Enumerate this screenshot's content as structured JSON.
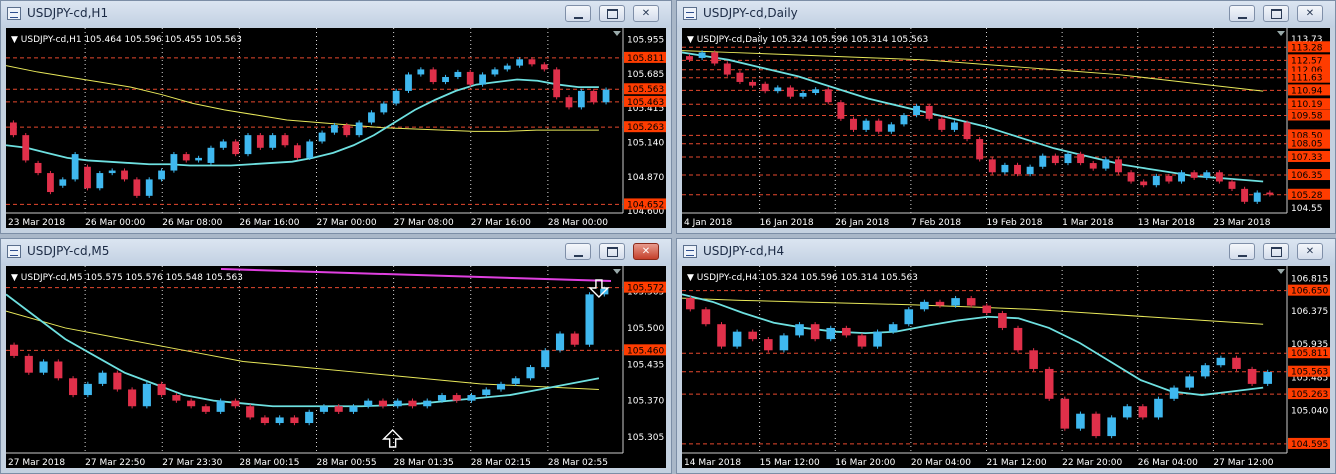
{
  "windows": [
    {
      "title": "USDJPY-cd,H1",
      "info": "▼ USDJPY-cd,H1  105.464 105.596 105.455 105.563",
      "active": false,
      "price_labels": [
        "105.955",
        "105.685",
        "105.415",
        "105.140",
        "104.870",
        "104.600"
      ],
      "tag_labels": [
        "105.811",
        "105.563",
        "105.463",
        "105.263",
        "104.652"
      ],
      "time_labels": [
        "23 Mar 2018",
        "26 Mar 00:00",
        "26 Mar 08:00",
        "26 Mar 16:00",
        "27 Mar 00:00",
        "27 Mar 08:00",
        "27 Mar 16:00",
        "28 Mar 00:00"
      ],
      "chart_data": {
        "type": "candlestick",
        "ylim": [
          104.6,
          106.0
        ],
        "candles": [
          [
            105.3,
            105.2
          ],
          [
            105.2,
            105.0
          ],
          [
            104.98,
            104.9
          ],
          [
            104.9,
            104.75
          ],
          [
            104.8,
            104.85
          ],
          [
            104.85,
            105.05
          ],
          [
            104.95,
            104.78
          ],
          [
            104.78,
            104.9
          ],
          [
            104.9,
            104.92
          ],
          [
            104.92,
            104.85
          ],
          [
            104.85,
            104.72
          ],
          [
            104.72,
            104.85
          ],
          [
            104.85,
            104.92
          ],
          [
            104.92,
            105.05
          ],
          [
            105.05,
            105.0
          ],
          [
            105.0,
            105.02
          ],
          [
            104.98,
            105.1
          ],
          [
            105.1,
            105.15
          ],
          [
            105.15,
            105.05
          ],
          [
            105.05,
            105.2
          ],
          [
            105.2,
            105.1
          ],
          [
            105.1,
            105.2
          ],
          [
            105.2,
            105.12
          ],
          [
            105.12,
            105.02
          ],
          [
            105.02,
            105.15
          ],
          [
            105.15,
            105.22
          ],
          [
            105.22,
            105.28
          ],
          [
            105.28,
            105.2
          ],
          [
            105.2,
            105.3
          ],
          [
            105.3,
            105.38
          ],
          [
            105.38,
            105.45
          ],
          [
            105.45,
            105.55
          ],
          [
            105.55,
            105.68
          ],
          [
            105.68,
            105.72
          ],
          [
            105.72,
            105.62
          ],
          [
            105.62,
            105.66
          ],
          [
            105.66,
            105.7
          ],
          [
            105.7,
            105.6
          ],
          [
            105.6,
            105.68
          ],
          [
            105.68,
            105.72
          ],
          [
            105.72,
            105.75
          ],
          [
            105.75,
            105.8
          ],
          [
            105.8,
            105.76
          ],
          [
            105.76,
            105.72
          ],
          [
            105.72,
            105.5
          ],
          [
            105.5,
            105.42
          ],
          [
            105.42,
            105.55
          ],
          [
            105.55,
            105.46
          ],
          [
            105.46,
            105.56
          ]
        ],
        "ma_fast": [
          105.12,
          105.1,
          105.06,
          105.02,
          105.0,
          104.99,
          104.98,
          104.97,
          104.97,
          104.96,
          104.96,
          104.96,
          104.97,
          104.98,
          104.99,
          105.02,
          105.06,
          105.12,
          105.2,
          105.3,
          105.4,
          105.48,
          105.55,
          105.6,
          105.62,
          105.64,
          105.63,
          105.6,
          105.58,
          105.58
        ],
        "ma_slow": [
          105.75,
          105.7,
          105.66,
          105.62,
          105.58,
          105.52,
          105.45,
          105.4,
          105.36,
          105.32,
          105.3,
          105.28,
          105.26,
          105.25,
          105.24,
          105.23,
          105.23,
          105.24,
          105.24,
          105.24
        ]
      }
    },
    {
      "title": "USDJPY-cd,Daily",
      "info": "▼ USDJPY-cd,Daily  105.324 105.596 105.314 105.563",
      "active": false,
      "price_labels": [
        "113.73",
        "113.28",
        "112.57",
        "112.06",
        "111.63",
        "110.94",
        "110.19",
        "109.58",
        "108.50",
        "108.05",
        "107.33",
        "106.35",
        "105.28",
        "104.55"
      ],
      "tag_labels": [
        "113.28",
        "112.57",
        "112.06",
        "111.63",
        "110.94",
        "110.19",
        "109.58",
        "108.50",
        "108.05",
        "107.33",
        "106.35",
        "105.28"
      ],
      "time_labels": [
        "4 Jan 2018",
        "16 Jan 2018",
        "26 Jan 2018",
        "7 Feb 2018",
        "19 Feb 2018",
        "1 Mar 2018",
        "13 Mar 2018",
        "23 Mar 2018"
      ],
      "chart_data": {
        "type": "candlestick",
        "ylim": [
          104.4,
          114.0
        ],
        "candles": [
          [
            112.8,
            112.6
          ],
          [
            112.7,
            113.0
          ],
          [
            113.0,
            112.4
          ],
          [
            112.4,
            111.8
          ],
          [
            111.9,
            111.4
          ],
          [
            111.4,
            111.2
          ],
          [
            111.3,
            110.9
          ],
          [
            110.9,
            111.1
          ],
          [
            111.1,
            110.6
          ],
          [
            110.6,
            110.8
          ],
          [
            110.8,
            111.0
          ],
          [
            111.0,
            110.3
          ],
          [
            110.3,
            109.4
          ],
          [
            109.4,
            108.8
          ],
          [
            108.8,
            109.3
          ],
          [
            109.3,
            108.7
          ],
          [
            108.7,
            109.1
          ],
          [
            109.1,
            109.6
          ],
          [
            109.6,
            110.1
          ],
          [
            110.1,
            109.4
          ],
          [
            109.4,
            108.8
          ],
          [
            108.8,
            109.2
          ],
          [
            109.2,
            108.3
          ],
          [
            108.3,
            107.2
          ],
          [
            107.2,
            106.5
          ],
          [
            106.5,
            106.9
          ],
          [
            106.9,
            106.4
          ],
          [
            106.4,
            106.8
          ],
          [
            106.8,
            107.4
          ],
          [
            107.4,
            107.0
          ],
          [
            107.0,
            107.5
          ],
          [
            107.5,
            107.0
          ],
          [
            107.0,
            106.7
          ],
          [
            106.7,
            107.2
          ],
          [
            107.2,
            106.5
          ],
          [
            106.5,
            106.0
          ],
          [
            106.0,
            105.8
          ],
          [
            105.8,
            106.3
          ],
          [
            106.3,
            106.0
          ],
          [
            106.0,
            106.5
          ],
          [
            106.5,
            106.2
          ],
          [
            106.2,
            106.5
          ],
          [
            106.5,
            106.0
          ],
          [
            106.0,
            105.6
          ],
          [
            105.6,
            104.9
          ],
          [
            104.9,
            105.4
          ],
          [
            105.4,
            105.3
          ]
        ],
        "ma_fast": [
          113.0,
          112.8,
          112.6,
          112.3,
          112.0,
          111.7,
          111.3,
          110.9,
          110.5,
          110.2,
          109.9,
          109.6,
          109.3,
          109.0,
          108.6,
          108.2,
          107.8,
          107.5,
          107.2,
          106.9,
          106.7,
          106.5,
          106.3,
          106.2,
          106.1,
          106.0
        ],
        "ma_slow": [
          113.1,
          113.0,
          112.9,
          112.8,
          112.7,
          112.6,
          112.4,
          112.2,
          112.0,
          111.8,
          111.5,
          111.2,
          110.9
        ]
      }
    },
    {
      "title": "USDJPY-cd,M5",
      "info": "▼ USDJPY-cd,M5  105.575 105.576 105.548 105.563",
      "active": true,
      "price_labels": [
        "105.565",
        "105.500",
        "105.435",
        "105.370",
        "105.305"
      ],
      "tag_labels": [
        "105.572",
        "105.460"
      ],
      "time_labels": [
        "27 Mar 2018",
        "27 Mar 22:50",
        "27 Mar 23:30",
        "28 Mar 00:15",
        "28 Mar 00:55",
        "28 Mar 01:35",
        "28 Mar 02:15",
        "28 Mar 02:55"
      ],
      "chart_data": {
        "type": "candlestick",
        "ylim": [
          105.28,
          105.6
        ],
        "candles": [
          [
            105.47,
            105.45
          ],
          [
            105.45,
            105.42
          ],
          [
            105.42,
            105.44
          ],
          [
            105.44,
            105.41
          ],
          [
            105.41,
            105.38
          ],
          [
            105.38,
            105.4
          ],
          [
            105.4,
            105.42
          ],
          [
            105.42,
            105.39
          ],
          [
            105.39,
            105.36
          ],
          [
            105.36,
            105.4
          ],
          [
            105.4,
            105.38
          ],
          [
            105.38,
            105.37
          ],
          [
            105.37,
            105.36
          ],
          [
            105.36,
            105.35
          ],
          [
            105.35,
            105.37
          ],
          [
            105.37,
            105.36
          ],
          [
            105.36,
            105.34
          ],
          [
            105.34,
            105.33
          ],
          [
            105.33,
            105.34
          ],
          [
            105.34,
            105.33
          ],
          [
            105.33,
            105.35
          ],
          [
            105.35,
            105.36
          ],
          [
            105.36,
            105.35
          ],
          [
            105.35,
            105.36
          ],
          [
            105.36,
            105.37
          ],
          [
            105.37,
            105.36
          ],
          [
            105.36,
            105.37
          ],
          [
            105.37,
            105.36
          ],
          [
            105.36,
            105.37
          ],
          [
            105.37,
            105.38
          ],
          [
            105.38,
            105.37
          ],
          [
            105.37,
            105.38
          ],
          [
            105.38,
            105.39
          ],
          [
            105.39,
            105.4
          ],
          [
            105.4,
            105.41
          ],
          [
            105.41,
            105.43
          ],
          [
            105.43,
            105.46
          ],
          [
            105.46,
            105.49
          ],
          [
            105.49,
            105.47
          ],
          [
            105.47,
            105.56
          ],
          [
            105.56,
            105.57
          ]
        ],
        "ma_fast": [
          105.56,
          105.52,
          105.48,
          105.45,
          105.42,
          105.4,
          105.38,
          105.37,
          105.365,
          105.36,
          105.36,
          105.36,
          105.36,
          105.362,
          105.365,
          105.37,
          105.375,
          105.38,
          105.39,
          105.4,
          105.41
        ],
        "ma_slow": [
          105.53,
          105.5,
          105.48,
          105.46,
          105.44,
          105.43,
          105.42,
          105.41,
          105.4,
          105.395,
          105.39
        ]
      }
    },
    {
      "title": "USDJPY-cd,H4",
      "info": "▼ USDJPY-cd,H4  105.324 105.596 105.314 105.563",
      "active": false,
      "price_labels": [
        "106.815",
        "106.650",
        "106.375",
        "105.935",
        "105.485",
        "105.040",
        "104.595"
      ],
      "tag_labels": [
        "106.650",
        "105.811",
        "105.563",
        "105.263",
        "104.595"
      ],
      "time_labels": [
        "14 Mar 2018",
        "15 Mar 12:00",
        "16 Mar 20:00",
        "20 Mar 04:00",
        "21 Mar 12:00",
        "22 Mar 20:00",
        "26 Mar 04:00",
        "27 Mar 12:00"
      ],
      "chart_data": {
        "type": "candlestick",
        "ylim": [
          104.5,
          106.9
        ],
        "candles": [
          [
            106.55,
            106.4
          ],
          [
            106.4,
            106.2
          ],
          [
            106.2,
            105.9
          ],
          [
            105.9,
            106.1
          ],
          [
            106.1,
            106.0
          ],
          [
            106.0,
            105.85
          ],
          [
            105.85,
            106.05
          ],
          [
            106.05,
            106.2
          ],
          [
            106.2,
            106.0
          ],
          [
            106.0,
            106.15
          ],
          [
            106.15,
            106.05
          ],
          [
            106.05,
            105.9
          ],
          [
            105.9,
            106.1
          ],
          [
            106.1,
            106.2
          ],
          [
            106.2,
            106.4
          ],
          [
            106.4,
            106.5
          ],
          [
            106.5,
            106.45
          ],
          [
            106.45,
            106.55
          ],
          [
            106.55,
            106.45
          ],
          [
            106.45,
            106.35
          ],
          [
            106.35,
            106.15
          ],
          [
            106.15,
            105.85
          ],
          [
            105.85,
            105.6
          ],
          [
            105.6,
            105.2
          ],
          [
            105.2,
            104.8
          ],
          [
            104.8,
            105.0
          ],
          [
            105.0,
            104.7
          ],
          [
            104.7,
            104.95
          ],
          [
            104.95,
            105.1
          ],
          [
            105.1,
            104.95
          ],
          [
            104.95,
            105.2
          ],
          [
            105.2,
            105.35
          ],
          [
            105.35,
            105.5
          ],
          [
            105.5,
            105.65
          ],
          [
            105.65,
            105.75
          ],
          [
            105.75,
            105.6
          ],
          [
            105.6,
            105.4
          ],
          [
            105.4,
            105.56
          ]
        ],
        "ma_fast": [
          106.6,
          106.5,
          106.35,
          106.22,
          106.15,
          106.1,
          106.08,
          106.1,
          106.18,
          106.25,
          106.3,
          106.28,
          106.15,
          105.95,
          105.7,
          105.45,
          105.3,
          105.25,
          105.3,
          105.35
        ],
        "ma_slow": [
          106.55,
          106.52,
          106.5,
          106.48,
          106.46,
          106.43,
          106.4,
          106.35,
          106.3,
          106.25,
          106.2
        ]
      }
    }
  ],
  "colors": {
    "bull": "#3fb8ef",
    "bear": "#e0304a",
    "ma_fast": "#6ee0e0",
    "ma_slow": "#e8e85a",
    "ma_magenta": "#e040e0",
    "tag_bg": "#ff3c00",
    "current_tag_bg": "#ffffff",
    "grid": "#e5482e",
    "text": "#ffffff"
  },
  "icons": [
    "window-icon",
    "minimize-icon",
    "maximize-icon",
    "close-icon",
    "arrow-down-icon",
    "arrow-up-icon"
  ]
}
